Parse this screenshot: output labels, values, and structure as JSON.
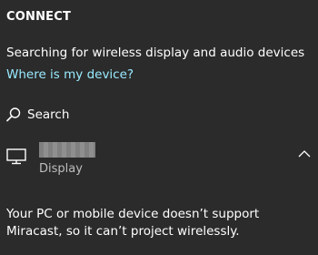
{
  "header": {
    "title": "CONNECT"
  },
  "status": {
    "text": "Searching for wireless display and audio devices"
  },
  "help": {
    "link_text": "Where is my device?",
    "link_color": "#99ebff"
  },
  "search": {
    "label": "Search",
    "icon": "search-icon"
  },
  "devices": [
    {
      "name": "",
      "name_redacted": true,
      "type": "Display",
      "icon": "monitor-icon",
      "expanded": true
    }
  ],
  "message": {
    "text": "Your PC or mobile device doesn’t support Miracast, so it can’t project wirelessly."
  },
  "colors": {
    "background": "#2b2b2b",
    "text": "#ffffff",
    "secondary_text": "#bdbdbd",
    "accent_link": "#99ebff"
  }
}
